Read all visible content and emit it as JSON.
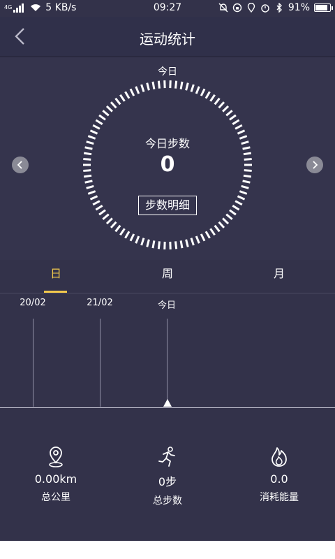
{
  "status_bar": {
    "network": "4G",
    "speed": "5 KB/s",
    "time": "09:27",
    "battery": "91%",
    "battery_level": 0.91
  },
  "header": {
    "title": "运动统计"
  },
  "today": {
    "top_label": "今日",
    "ring_label": "今日步数",
    "steps_value": "0",
    "detail_button": "步数明细"
  },
  "tabs": [
    {
      "label": "日",
      "active": true
    },
    {
      "label": "周",
      "active": false
    },
    {
      "label": "月",
      "active": false
    }
  ],
  "timeline": {
    "labels": [
      "20/02",
      "21/02",
      "今日"
    ]
  },
  "stats": {
    "distance": {
      "value": "0.00km",
      "label": "总公里",
      "icon": "location-pin-icon"
    },
    "steps": {
      "value": "0步",
      "label": "总步数",
      "icon": "running-icon"
    },
    "energy": {
      "value": "0.0",
      "label": "消耗能量",
      "icon": "flame-icon"
    }
  },
  "colors": {
    "background": "#33324a",
    "accent": "#f2c94c"
  }
}
